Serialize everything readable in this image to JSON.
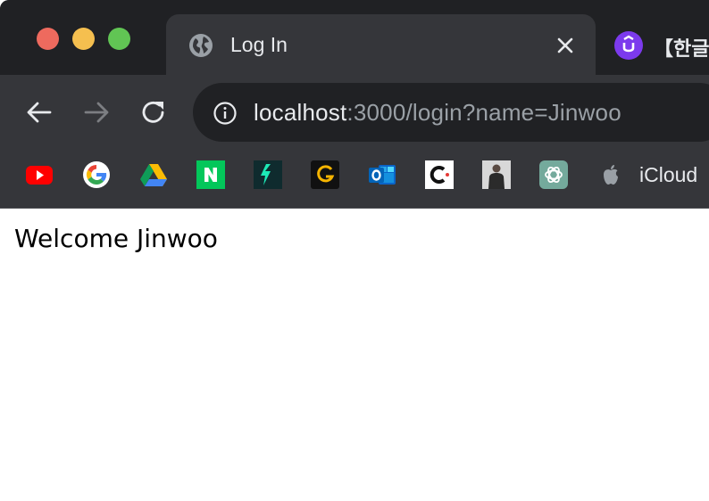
{
  "window": {
    "traffic_lights": {
      "close": "#ee6a5e",
      "minimize": "#f5bf4f",
      "zoom": "#61c554"
    }
  },
  "tabs": [
    {
      "title": "Log In",
      "icon": "globe-icon",
      "active": true
    },
    {
      "title": "【한글자",
      "icon": "udemy-icon",
      "active": false
    }
  ],
  "toolbar": {
    "back_icon": "back-arrow-icon",
    "forward_icon": "forward-arrow-icon",
    "reload_icon": "reload-icon"
  },
  "address_bar": {
    "host": "localhost",
    "rest": ":3000/login?name=Jinwoo",
    "icon": "info-icon"
  },
  "bookmarks": [
    {
      "icon": "youtube-icon"
    },
    {
      "icon": "google-icon"
    },
    {
      "icon": "google-drive-icon"
    },
    {
      "icon": "naver-icon"
    },
    {
      "icon": "deepl-icon"
    },
    {
      "icon": "g-app-icon"
    },
    {
      "icon": "outlook-icon"
    },
    {
      "icon": "c-app-icon"
    },
    {
      "icon": "profile-photo-icon"
    },
    {
      "icon": "chatgpt-icon"
    },
    {
      "icon": "apple-icon",
      "label": "iCloud"
    }
  ],
  "page": {
    "heading": "Welcome Jinwoo"
  }
}
